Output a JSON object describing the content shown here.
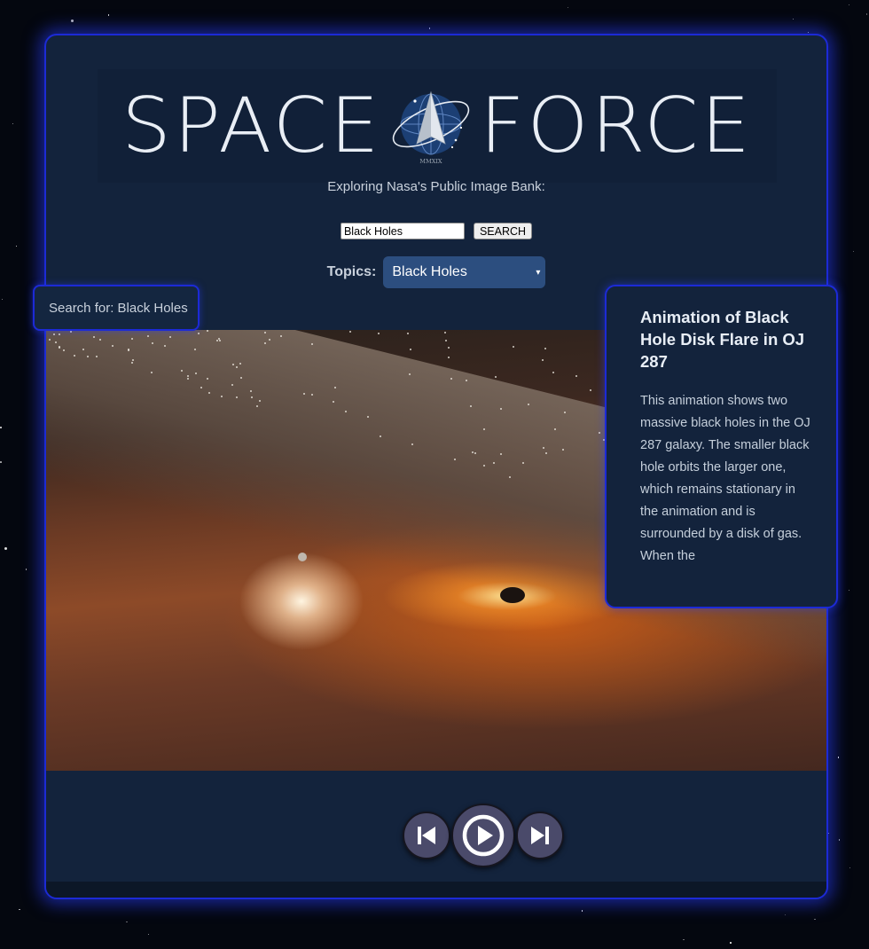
{
  "app": {
    "logo_left": "SPACE",
    "logo_right": "FORCE",
    "seal_text": "MMXIX",
    "subtitle": "Exploring Nasa's Public Image Bank:"
  },
  "search": {
    "value": "Black Holes",
    "button_label": "SEARCH"
  },
  "topics": {
    "label": "Topics:",
    "selected": "Black Holes"
  },
  "current_search": "Search for: Black Holes",
  "image": {
    "title": "Animation of Black Hole Disk Flare in OJ 287",
    "description": "This animation shows two massive black holes in the OJ 287 galaxy. The smaller black hole orbits the larger one, which remains stationary in the animation and is surrounded by a disk of gas. When the"
  },
  "controls": {
    "prev_icon": "skip-previous-icon",
    "play_icon": "play-circle-icon",
    "next_icon": "skip-next-icon"
  },
  "colors": {
    "panel": "#13233c",
    "border_glow": "#1c2ad6",
    "select_bg": "#2c4e7f",
    "control_bg": "#4a4a6a"
  }
}
